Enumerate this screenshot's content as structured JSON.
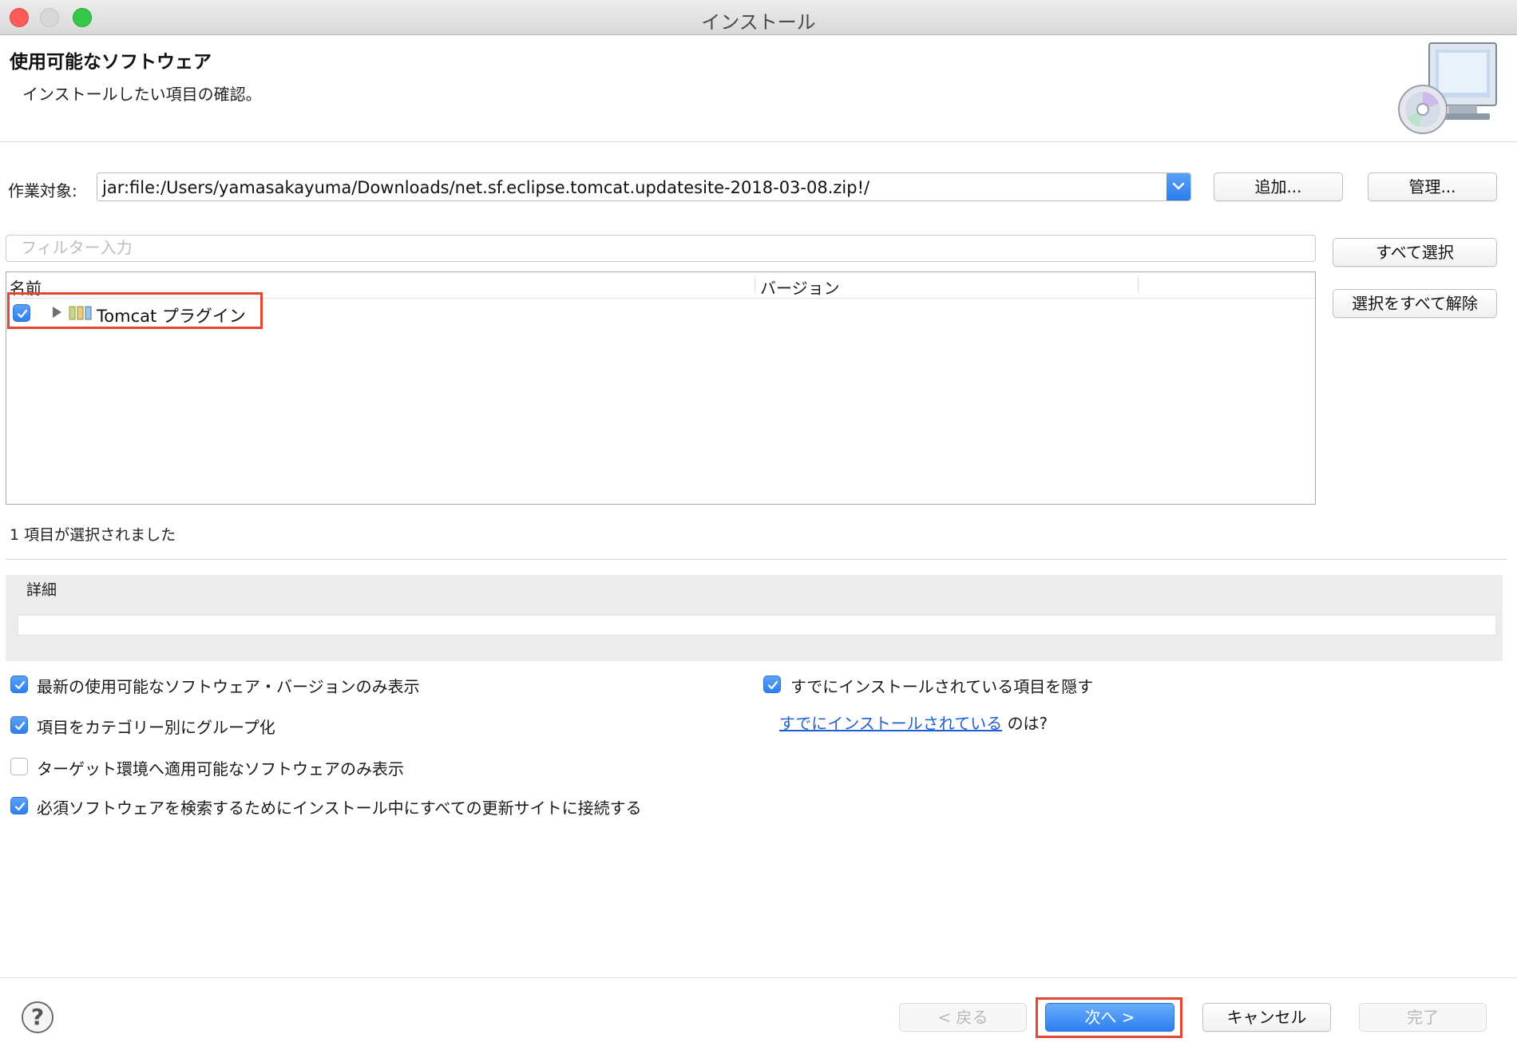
{
  "window": {
    "title": "インストール"
  },
  "header": {
    "title": "使用可能なソフトウェア",
    "description": "インストールしたい項目の確認。"
  },
  "work_with": {
    "label": "作業対象:",
    "value": "jar:file:/Users/yamasakayuma/Downloads/net.sf.eclipse.tomcat.updatesite-2018-03-08.zip!/",
    "add_button": "追加...",
    "manage_button": "管理..."
  },
  "filter": {
    "placeholder": "フィルター入力",
    "value": ""
  },
  "side_buttons": {
    "select_all": "すべて選択",
    "deselect_all": "選択をすべて解除"
  },
  "tree": {
    "columns": [
      "名前",
      "バージョン"
    ],
    "items": [
      {
        "label": "Tomcat プラグイン",
        "version": "",
        "checked": true,
        "expanded": false,
        "icon": "feature-icon"
      }
    ]
  },
  "status": {
    "selection_count": "1 項目が選択されました"
  },
  "details": {
    "label": "詳細",
    "text": ""
  },
  "options": {
    "latest_only": {
      "label": "最新の使用可能なソフトウェア・バージョンのみ表示",
      "checked": true
    },
    "group_by_category": {
      "label": "項目をカテゴリー別にグループ化",
      "checked": true
    },
    "target_env_only": {
      "label": "ターゲット環境へ適用可能なソフトウェアのみ表示",
      "checked": false
    },
    "contact_all_sites": {
      "label": "必須ソフトウェアを検索するためにインストール中にすべての更新サイトに接続する",
      "checked": true
    },
    "hide_installed": {
      "label": "すでにインストールされている項目を隠す",
      "checked": true
    },
    "already_installed_link": "すでにインストールされている",
    "already_installed_suffix": "のは?"
  },
  "footer": {
    "back": "< 戻る",
    "next": "次へ >",
    "cancel": "キャンセル",
    "finish": "完了",
    "help_icon": "question-icon"
  },
  "colors": {
    "accent": "#2d7ef0",
    "highlight": "#e2462c",
    "link": "#1f5fd1"
  }
}
